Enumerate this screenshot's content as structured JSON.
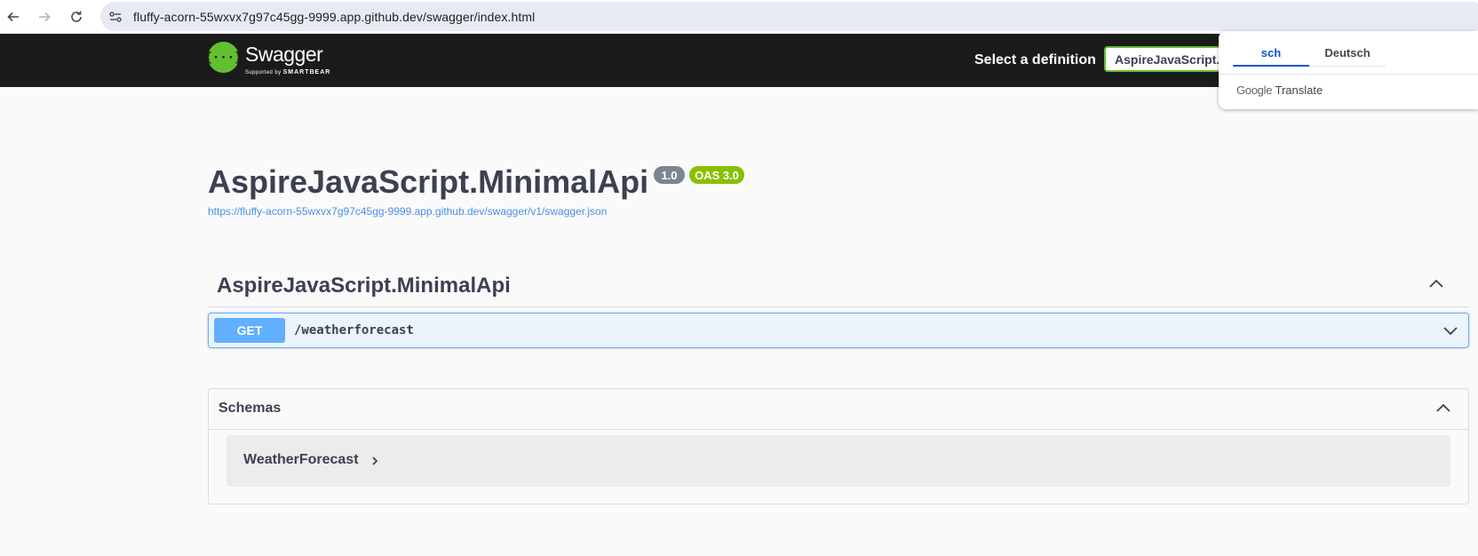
{
  "browser": {
    "url": "fluffy-acorn-55wxvx7g97c45gg-9999.app.github.dev/swagger/index.html"
  },
  "topbar": {
    "logo_mark": "{···}",
    "logo_word": "Swagger",
    "logo_sub_prefix": "Supported by",
    "logo_sub_brand": "SMARTBEAR",
    "select_label": "Select a definition",
    "select_value": "AspireJavaScript.MinimalApi v1"
  },
  "info": {
    "title": "AspireJavaScript.MinimalApi",
    "version": "1.0",
    "oas": "OAS 3.0",
    "spec_url": "https://fluffy-acorn-55wxvx7g97c45gg-9999.app.github.dev/swagger/v1/swagger.json"
  },
  "tag": {
    "name": "AspireJavaScript.MinimalApi"
  },
  "operations": [
    {
      "method": "GET",
      "path": "/weatherforecast"
    }
  ],
  "schemas": {
    "title": "Schemas",
    "models": [
      "WeatherForecast"
    ]
  },
  "translate": {
    "tab_source": "sch",
    "tab_target": "Deutsch",
    "footer_brand": "Google",
    "footer_label": "Translate"
  },
  "colors": {
    "get": "#61affe",
    "swagger_green": "#62c030",
    "oas_badge": "#89bf04",
    "version_badge": "#7d8492",
    "link": "#4990e2"
  }
}
